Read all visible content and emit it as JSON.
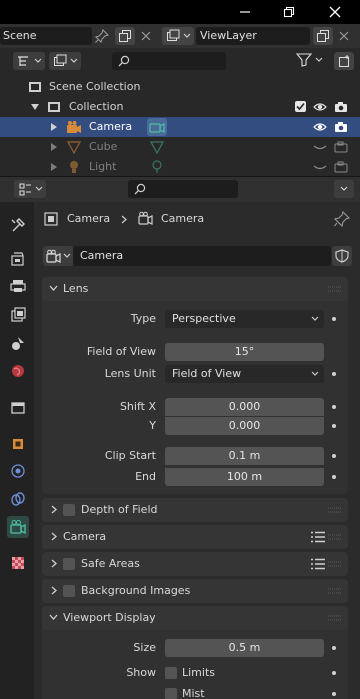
{
  "window": {
    "controls": [
      "minimize-icon",
      "maximize-icon",
      "close-icon"
    ]
  },
  "topbar": {
    "scene_name": "Scene",
    "view_layer_name": "ViewLayer"
  },
  "outliner": {
    "search_placeholder": "",
    "rows": [
      {
        "label": "Scene Collection"
      },
      {
        "label": "Collection"
      },
      {
        "label": "Camera"
      },
      {
        "label": "Cube"
      },
      {
        "label": "Light"
      }
    ]
  },
  "properties": {
    "search_placeholder": "",
    "breadcrumb": {
      "object": "Camera",
      "data": "Camera"
    },
    "datablock_name": "Camera",
    "lens_panel": {
      "title": "Lens",
      "type_label": "Type",
      "type_value": "Perspective",
      "fov_label": "Field of View",
      "fov_value": "15°",
      "lens_unit_label": "Lens Unit",
      "lens_unit_value": "Field of View",
      "shift_x_label": "Shift X",
      "shift_x_value": "0.000",
      "shift_y_label": "Y",
      "shift_y_value": "0.000",
      "clip_start_label": "Clip Start",
      "clip_start_value": "0.1 m",
      "clip_end_label": "End",
      "clip_end_value": "100 m"
    },
    "collapsed_panels": {
      "dof": "Depth of Field",
      "camera": "Camera",
      "safe_areas": "Safe Areas",
      "background_images": "Background Images"
    },
    "viewport_display": {
      "title": "Viewport Display",
      "size_label": "Size",
      "size_value": "0.5 m",
      "show_label": "Show",
      "limits_label": "Limits",
      "mist_label": "Mist"
    }
  },
  "colors": {
    "selection": "#334d80",
    "camera_orange": "#d88c3a",
    "data_green": "#4fbfa3",
    "panel": "#313131"
  }
}
